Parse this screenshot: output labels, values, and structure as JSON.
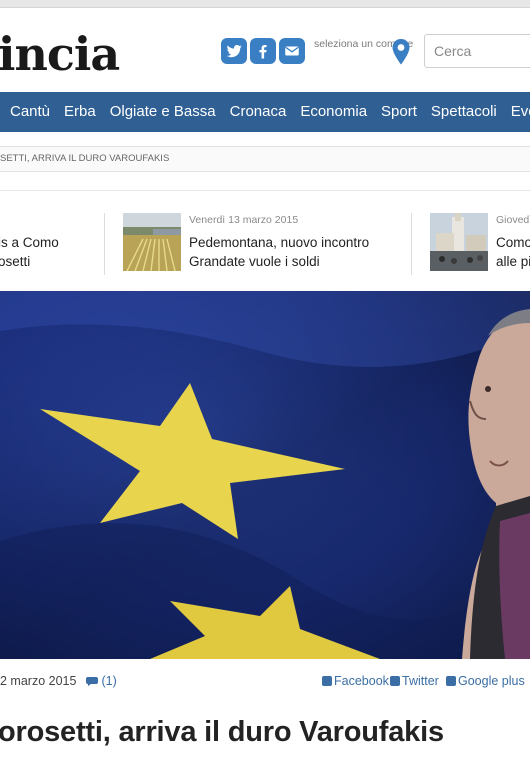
{
  "header": {
    "logo_text": "incia",
    "social": {
      "twitter_icon": "twitter-icon",
      "facebook_icon": "facebook-icon",
      "email_icon": "mail-icon"
    },
    "comune_hint": "seleziona un comune",
    "location_icon": "map-pin-icon",
    "search_placeholder": "Cerca"
  },
  "nav": {
    "items": [
      "Cantù",
      "Erba",
      "Olgiate e Bassa",
      "Cronaca",
      "Economia",
      "Sport",
      "Spettacoli",
      "Eve"
    ]
  },
  "breadcrumb": {
    "text": "SETTI, ARRIVA IL DURO VAROUFAKIS"
  },
  "related": [
    {
      "date": "",
      "title_line1": "is a Como",
      "title_line2": "osetti"
    },
    {
      "date": "Venerdì 13 marzo 2015",
      "title_line1": "Pedemontana, nuovo incontro",
      "title_line2": "Grandate vuole i soldi"
    },
    {
      "date": "Giovedì",
      "title_line1": "Como",
      "title_line2": "alle pi"
    }
  ],
  "article": {
    "date": "2 marzo 2015",
    "comments": "(1)",
    "comments_icon": "speech-bubble-icon",
    "share": {
      "facebook": "Facebook",
      "twitter": "Twitter",
      "google": "Google plus"
    },
    "headline": "orosetti, arriva il duro Varoufakis"
  },
  "colors": {
    "nav_bg": "#2f5f93",
    "social_blue": "#3a7fc4",
    "link_blue": "#3a6ea5",
    "eu_blue": "#1b2f78",
    "eu_star": "#e8d44d"
  }
}
